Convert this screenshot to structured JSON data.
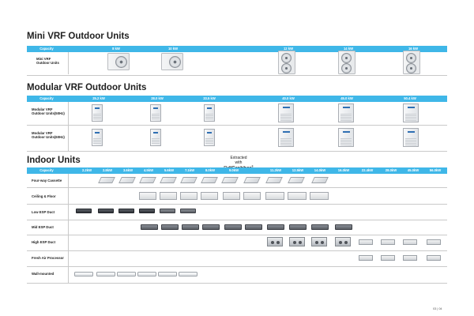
{
  "mini_section": {
    "title": "Mini VRF Outdoor Units",
    "header_label": "Capacity",
    "capacities": [
      "8 kW",
      "10 kW",
      "12 kW",
      "14 kW",
      "16 kW"
    ],
    "row_label": "Mini VRF\nOutdoor Units"
  },
  "modular_section": {
    "title": "Modular VRF Outdoor Units",
    "header_label": "Capacity",
    "capacities": [
      "25.2 kW",
      "28.0 kW",
      "33.5 kW",
      "40.0 kW",
      "45.0 kW",
      "50.4 kW"
    ],
    "rows": [
      "Modular VRF\nOutdoor Units(50Hz)",
      "Modular VRF\nOutdoor Units(60Hz)"
    ]
  },
  "indoor_section": {
    "title": "Indoor Units",
    "header_label": "Capacity",
    "capacities": [
      "2.2kW",
      "2.8kW",
      "3.6kW",
      "4.5kW",
      "5.6kW",
      "7.1kW",
      "8.0kW",
      "9.0kW",
      "11.2kW",
      "12.5kW",
      "14.0kW",
      "16.0kW",
      "22.4kW",
      "28.0kW",
      "45.0kW",
      "56.0kW"
    ],
    "rows": [
      "Four-way Cassette",
      "Ceiling & Floor",
      "Low ESP Duct",
      "Mid ESP Duct",
      "High ESP Duct",
      "Fresh Air Processor",
      "Wall-mounted"
    ]
  },
  "watermark": {
    "line1": "Extracted",
    "line2": "with",
    "brand_a": "Pdf",
    "brand_b": "Grabber",
    "mark": "®"
  },
  "footer": {
    "page": "03 | 04"
  },
  "colors": {
    "header_bar": "#3fb7e8",
    "divider": "#c9c9c9"
  }
}
